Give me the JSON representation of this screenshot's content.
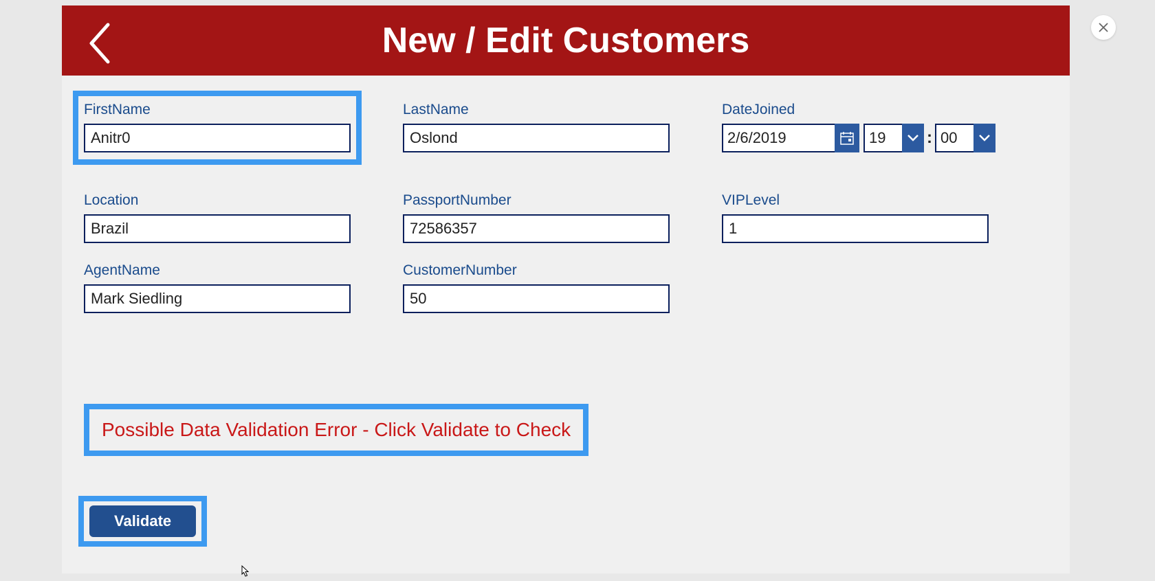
{
  "header": {
    "title": "New / Edit Customers"
  },
  "fields": {
    "firstName": {
      "label": "FirstName",
      "value": "Anitr0"
    },
    "lastName": {
      "label": "LastName",
      "value": "Oslond"
    },
    "dateJoined": {
      "label": "DateJoined",
      "date": "2/6/2019",
      "hour": "19",
      "minute": "00",
      "separator": ":"
    },
    "location": {
      "label": "Location",
      "value": "Brazil"
    },
    "passportNumber": {
      "label": "PassportNumber",
      "value": "72586357"
    },
    "vipLevel": {
      "label": "VIPLevel",
      "value": "1"
    },
    "agentName": {
      "label": "AgentName",
      "value": "Mark Siedling"
    },
    "customerNumber": {
      "label": "CustomerNumber",
      "value": "50"
    }
  },
  "warning": {
    "text": "Possible Data Validation Error - Click Validate to Check"
  },
  "buttons": {
    "validate": "Validate"
  }
}
